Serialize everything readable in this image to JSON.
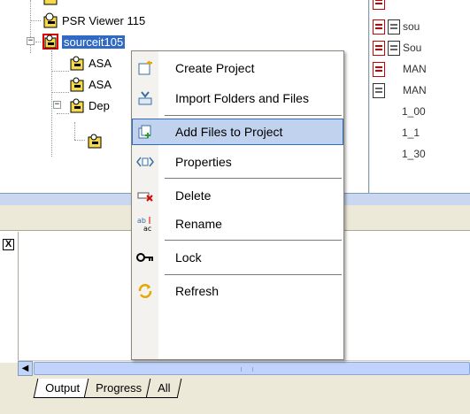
{
  "tree": {
    "items": [
      {
        "label": "PSR Viewer 115"
      },
      {
        "label": "sourceit105",
        "selected": true
      },
      {
        "label": "ASA"
      },
      {
        "label": "ASA"
      },
      {
        "label": "Dep"
      }
    ]
  },
  "files": {
    "items": [
      {
        "label": "sou"
      },
      {
        "label": "sou"
      },
      {
        "label": "Sou"
      },
      {
        "label": "MAN"
      },
      {
        "label": "MAN"
      },
      {
        "label": "1_00"
      },
      {
        "label": "1_1"
      },
      {
        "label": "1_30"
      }
    ]
  },
  "context_menu": {
    "items": [
      {
        "label": "Create Project",
        "icon": "create-project-icon"
      },
      {
        "label": "Import Folders and Files",
        "icon": "import-icon"
      },
      {
        "label": "Add Files to Project",
        "icon": "add-files-icon",
        "highlighted": true
      },
      {
        "label": "Properties",
        "icon": "properties-icon"
      },
      {
        "label": "Delete",
        "icon": "delete-icon"
      },
      {
        "label": "Rename",
        "icon": "rename-icon"
      },
      {
        "label": "Lock",
        "icon": "lock-icon"
      },
      {
        "label": "Refresh",
        "icon": "refresh-icon"
      }
    ]
  },
  "output_panel": {
    "close_symbol": "X",
    "tabs": [
      {
        "label": "Output",
        "active": true
      },
      {
        "label": "Progress",
        "active": false
      },
      {
        "label": "All",
        "active": false
      }
    ]
  },
  "colors": {
    "selection": "#316ac5",
    "highlight": "#c1d2ee",
    "chrome": "#ece9d8"
  }
}
